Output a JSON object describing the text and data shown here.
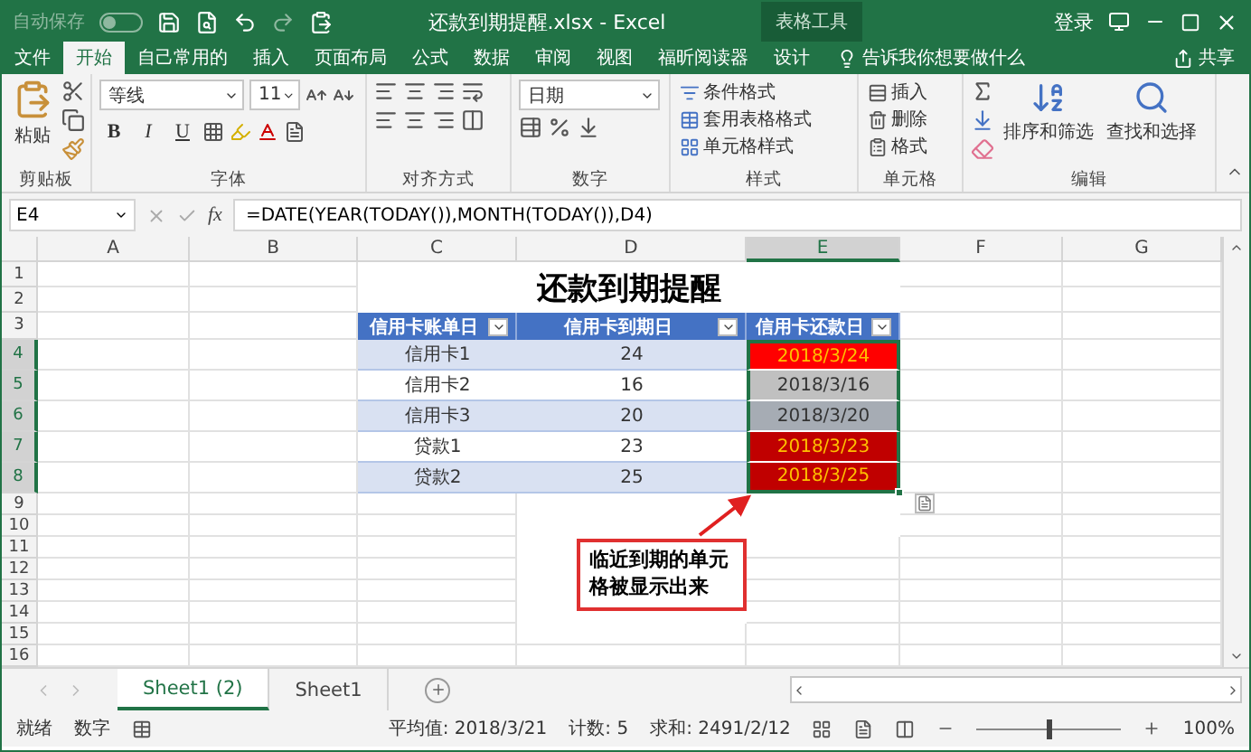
{
  "quick_access": {
    "autosave_label": "自动保存",
    "autosave_on": false
  },
  "window": {
    "title": "还款到期提醒.xlsx  -  Excel",
    "context_tab": "表格工具",
    "sign_in": "登录"
  },
  "ribbon_tabs": [
    {
      "label": "文件",
      "selected": false
    },
    {
      "label": "开始",
      "selected": true
    },
    {
      "label": "自己常用的",
      "selected": false
    },
    {
      "label": "插入",
      "selected": false
    },
    {
      "label": "页面布局",
      "selected": false
    },
    {
      "label": "公式",
      "selected": false
    },
    {
      "label": "数据",
      "selected": false
    },
    {
      "label": "审阅",
      "selected": false
    },
    {
      "label": "视图",
      "selected": false
    },
    {
      "label": "福昕阅读器",
      "selected": false
    },
    {
      "label": "设计",
      "selected": false
    }
  ],
  "tell_me": "告诉我你想要做什么",
  "share": "共享",
  "ribbon": {
    "paste": "粘贴",
    "clipboard": "剪贴板",
    "font_name": "等线",
    "font_size": "11",
    "font_styles": [
      "B",
      "I",
      "U"
    ],
    "font": "字体",
    "alignment": "对齐方式",
    "number_format": "日期",
    "number": "数字",
    "style_items": [
      "条件格式",
      "套用表格格式",
      "单元格样式"
    ],
    "styles": "样式",
    "cell_items": [
      "插入",
      "删除",
      "格式"
    ],
    "cells": "单元格",
    "sort": "排序和筛选",
    "find": "查找和选择",
    "editing": "编辑"
  },
  "formula_bar": {
    "name_box": "E4",
    "fx": "fx",
    "formula": "=DATE(YEAR(TODAY()),MONTH(TODAY()),D4)"
  },
  "columns": [
    {
      "label": "A",
      "selected": false
    },
    {
      "label": "B",
      "selected": false
    },
    {
      "label": "C",
      "selected": false
    },
    {
      "label": "D",
      "selected": false
    },
    {
      "label": "E",
      "selected": true
    },
    {
      "label": "F",
      "selected": false
    },
    {
      "label": "G",
      "selected": false
    }
  ],
  "rows": [
    {
      "label": "1",
      "selected": false
    },
    {
      "label": "2",
      "selected": false
    },
    {
      "label": "3",
      "selected": false
    },
    {
      "label": "4",
      "selected": true
    },
    {
      "label": "5",
      "selected": true
    },
    {
      "label": "6",
      "selected": true
    },
    {
      "label": "7",
      "selected": true
    },
    {
      "label": "8",
      "selected": true
    },
    {
      "label": "9",
      "selected": false
    },
    {
      "label": "10",
      "selected": false
    },
    {
      "label": "11",
      "selected": false
    },
    {
      "label": "12",
      "selected": false
    },
    {
      "label": "13",
      "selected": false
    },
    {
      "label": "14",
      "selected": false
    },
    {
      "label": "15",
      "selected": false
    },
    {
      "label": "16",
      "selected": false
    }
  ],
  "sheet_title": "还款到期提醒",
  "table": {
    "columns": [
      "信用卡账单日",
      "信用卡到期日",
      "信用卡还款日"
    ],
    "rows": [
      {
        "name": "信用卡1",
        "due_day": "24",
        "repay_date": "2018/3/24",
        "color": "#ff0000",
        "alert": true,
        "selected": true
      },
      {
        "name": "信用卡2",
        "due_day": "16",
        "repay_date": "2018/3/16",
        "color": "#c0c0c0",
        "alert": false,
        "selected": true
      },
      {
        "name": "信用卡3",
        "due_day": "20",
        "repay_date": "2018/3/20",
        "color": "#a6acb4",
        "alert": false,
        "selected": true
      },
      {
        "name": "贷款1",
        "due_day": "23",
        "repay_date": "2018/3/23",
        "color": "#c00000",
        "alert": true,
        "selected": true
      },
      {
        "name": "贷款2",
        "due_day": "25",
        "repay_date": "2018/3/25",
        "color": "#c00000",
        "alert": true,
        "selected": true
      }
    ]
  },
  "callout": "临近到期的单元格被显示出来",
  "sheet_tabs": [
    {
      "label": "Sheet1 (2)",
      "selected": true
    },
    {
      "label": "Sheet1",
      "selected": false
    }
  ],
  "status_bar": {
    "ready": "就绪",
    "mode": "数字",
    "average": "平均值: 2018/3/21",
    "count": "计数: 5",
    "sum": "求和: 2491/2/12",
    "zoom": "100%",
    "zoom_slider": {
      "level": 0.5
    }
  }
}
